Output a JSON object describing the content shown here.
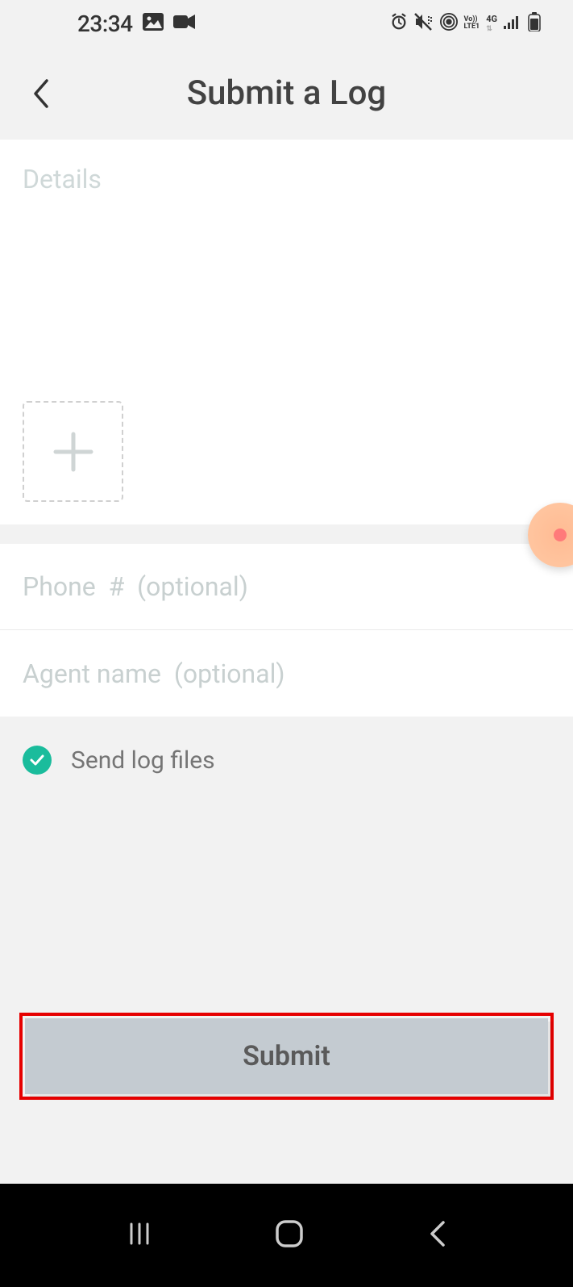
{
  "status": {
    "time": "23:34"
  },
  "header": {
    "title": "Submit a Log"
  },
  "form": {
    "details_placeholder": "Details",
    "phone_placeholder": "Phone  #  (optional)",
    "agent_placeholder": "Agent name  (optional)",
    "send_logs_label": "Send log files",
    "send_logs_checked": true,
    "submit_label": "Submit"
  }
}
